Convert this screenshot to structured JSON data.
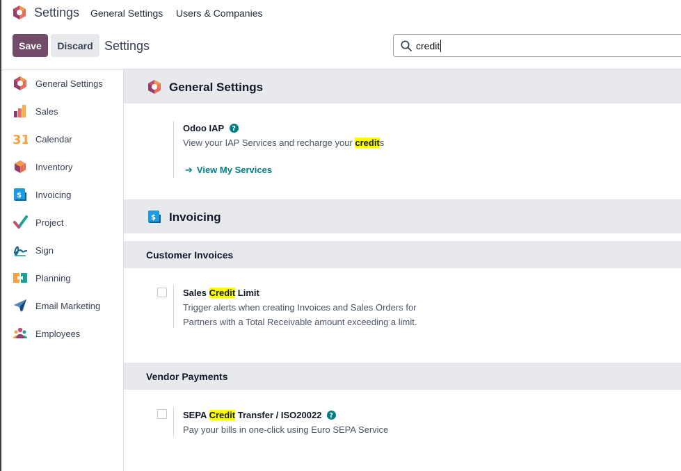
{
  "navbar": {
    "app_title": "Settings",
    "links": [
      "General Settings",
      "Users & Companies"
    ]
  },
  "control_panel": {
    "save_label": "Save",
    "discard_label": "Discard",
    "breadcrumb": "Settings",
    "search_value": "credit"
  },
  "sidebar": {
    "items": [
      {
        "label": "General Settings",
        "icon": "odoo-logo-icon"
      },
      {
        "label": "Sales",
        "icon": "sales-icon"
      },
      {
        "label": "Calendar",
        "icon": "calendar-icon"
      },
      {
        "label": "Inventory",
        "icon": "inventory-icon"
      },
      {
        "label": "Invoicing",
        "icon": "invoicing-icon"
      },
      {
        "label": "Project",
        "icon": "project-icon"
      },
      {
        "label": "Sign",
        "icon": "sign-icon"
      },
      {
        "label": "Planning",
        "icon": "planning-icon"
      },
      {
        "label": "Email Marketing",
        "icon": "email-marketing-icon"
      },
      {
        "label": "Employees",
        "icon": "employees-icon"
      }
    ],
    "calendar_icon_text": "31"
  },
  "sections": {
    "general": {
      "title": "General Settings",
      "iap": {
        "title": "Odoo IAP",
        "desc_before": "View your IAP Services and recharge your ",
        "desc_highlight": "credit",
        "desc_after": "s",
        "link_label": "View My Services"
      }
    },
    "invoicing": {
      "title": "Invoicing",
      "customer_invoices": {
        "title": "Customer Invoices",
        "setting": {
          "title_before": "Sales ",
          "title_highlight": "Credit",
          "title_after": " Limit",
          "desc_line1": "Trigger alerts when creating Invoices and Sales Orders for",
          "desc_line2": "Partners with a Total Receivable amount exceeding a limit."
        }
      },
      "vendor_payments": {
        "title": "Vendor Payments",
        "setting": {
          "title_before": "SEPA ",
          "title_highlight": "Credit",
          "title_after": " Transfer / ISO20022",
          "desc": "Pay your bills in one-click using Euro SEPA Service"
        }
      }
    }
  },
  "colors": {
    "brand": "#714b67",
    "link": "#017e84",
    "highlight": "#ffff00",
    "section_bg": "#e7e9ed"
  }
}
